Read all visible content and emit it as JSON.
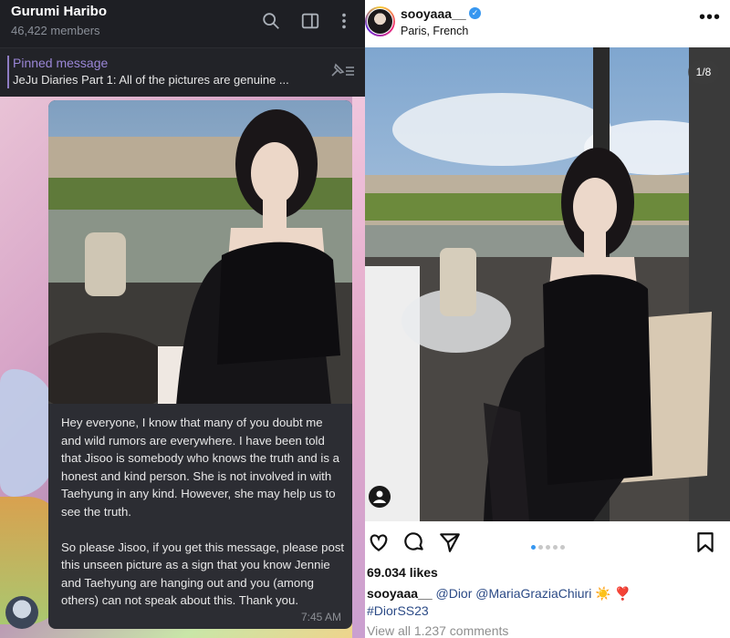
{
  "telegram": {
    "group_name": "Gurumi Haribo",
    "members": "46,422 members",
    "pinned": {
      "title": "Pinned message",
      "text": "JeJu Diaries Part 1:  All of the pictures are genuine ..."
    },
    "message": {
      "text": "Hey everyone, I know that many of you doubt me and wild rumors are everywhere. I have been told that Jisoo is somebody who knows the truth and is a honest and kind person. She is not involved in with Taehyung in any kind. However, she may help us to see the truth.\n\nSo please Jisoo, if you get this message, please post this unseen picture as a sign that you know Jennie and Taehyung are hanging out and you (among others) can not speak about this. Thank you.",
      "time": "7:45 AM"
    },
    "icons": [
      "search-icon",
      "sidebar-icon",
      "more-vertical-icon",
      "pin-icon"
    ]
  },
  "instagram": {
    "username": "sooyaaa__",
    "location": "Paris, French",
    "image_counter": "1/8",
    "carousel_dots": 5,
    "active_dot": 0,
    "likes": "69.034 likes",
    "caption": {
      "user": "sooyaaa__",
      "mention1": "@Dior",
      "mention2": "@MariaGraziaChiuri",
      "emojis": "☀️ ❣️",
      "hashtag": "#DiorSS23"
    },
    "comments_link": "View all 1.237 comments",
    "icons": [
      "heart-icon",
      "comment-icon",
      "share-icon",
      "bookmark-icon",
      "verified-icon",
      "more-horizontal-icon",
      "user-tag-icon"
    ],
    "colors": {
      "verified": "#3797f0",
      "link": "#2b4a86"
    }
  }
}
